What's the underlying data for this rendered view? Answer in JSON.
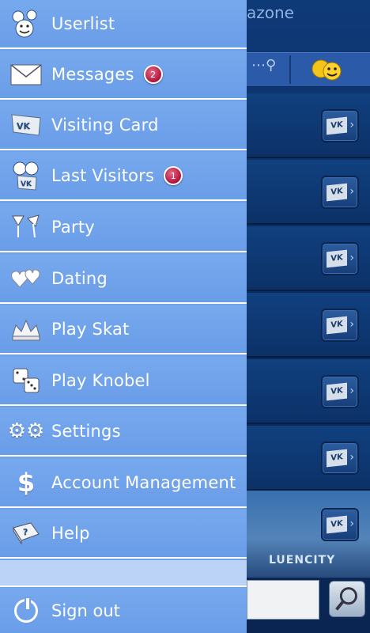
{
  "background_app": {
    "title_fragment": "azone",
    "list_button_label": "VK",
    "city_text": "LUENCITY"
  },
  "drawer": {
    "items": [
      {
        "name": "userlist",
        "label": "Userlist",
        "icon": "smiley-group-icon"
      },
      {
        "name": "messages",
        "label": "Messages",
        "icon": "envelope-icon",
        "badge": "2"
      },
      {
        "name": "visiting-card",
        "label": "Visiting Card",
        "icon": "vk-card-icon"
      },
      {
        "name": "last-visitors",
        "label": "Last Visitors",
        "icon": "visitors-icon",
        "badge": "1"
      },
      {
        "name": "party",
        "label": "Party",
        "icon": "cocktail-glasses-icon"
      },
      {
        "name": "dating",
        "label": "Dating",
        "icon": "hearts-icon"
      },
      {
        "name": "play-skat",
        "label": "Play Skat",
        "icon": "crown-icon"
      },
      {
        "name": "play-knobel",
        "label": "Play Knobel",
        "icon": "dice-icon"
      },
      {
        "name": "settings",
        "label": "Settings",
        "icon": "gears-icon"
      },
      {
        "name": "account-management",
        "label": "Account Management",
        "icon": "dollar-icon"
      },
      {
        "name": "help",
        "label": "Help",
        "icon": "help-book-icon"
      }
    ],
    "signout": {
      "label": "Sign out",
      "icon": "power-icon"
    }
  },
  "colors": {
    "drawer_bg": "#6fa2ea",
    "divider": "#ffffff",
    "badge": "#b0123c",
    "background_app": "#0c2d62"
  }
}
